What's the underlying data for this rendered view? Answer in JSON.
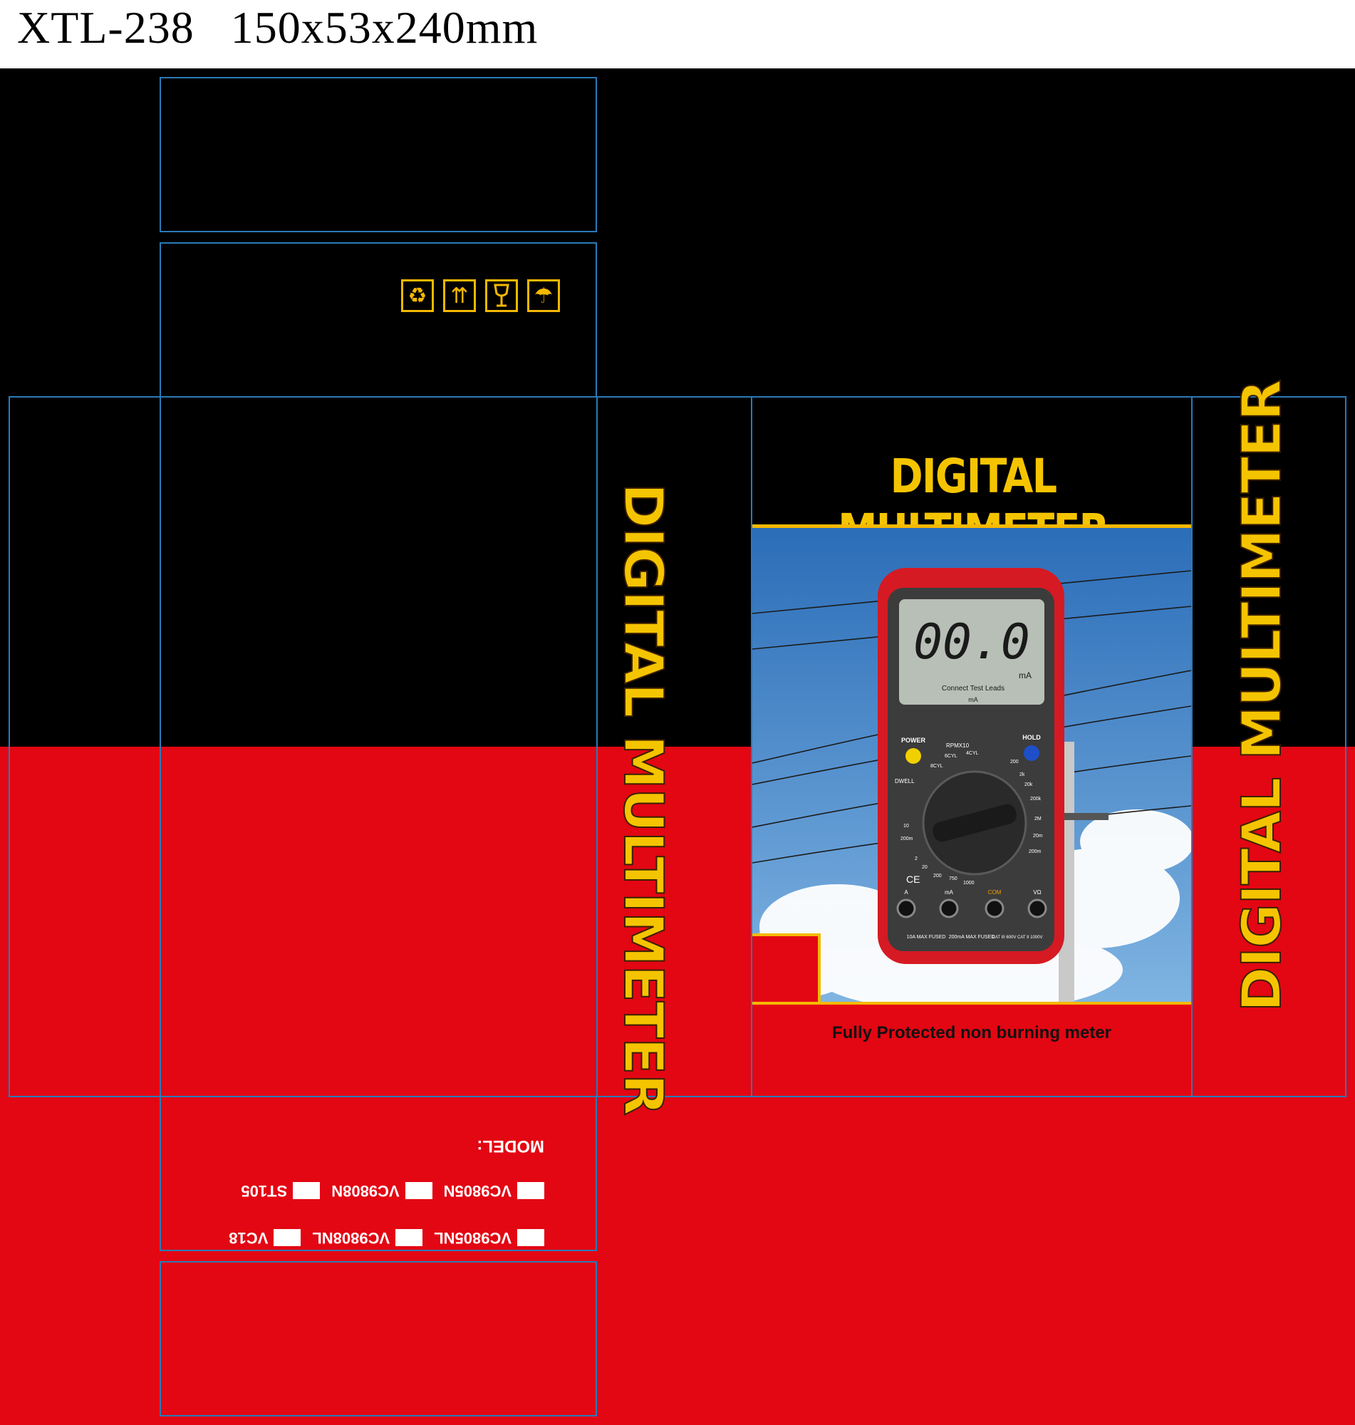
{
  "header": {
    "spec": "XTL-238   150x53x240mm"
  },
  "handling_symbols": [
    {
      "icon": "recycle-icon",
      "glyph": "♻"
    },
    {
      "icon": "this-way-up-icon",
      "glyph": "⇈"
    },
    {
      "icon": "fragile-glass-icon",
      "glyph": "🍷"
    },
    {
      "icon": "keep-dry-umbrella-icon",
      "glyph": "☂"
    }
  ],
  "side_panel_left": {
    "title": "DIGITAL MULTIMETER"
  },
  "side_panel_right": {
    "title": "DIGITAL MULTIMETER"
  },
  "front": {
    "title": "DIGITAL MULTIMETER",
    "tagline": "Fully Protected non burning meter"
  },
  "meter": {
    "display_value": "00.0",
    "display_unit": "mA",
    "warning_text": "Connect  Test  Leads",
    "probe_hint": "mA",
    "power_label": "POWER",
    "hold_label": "HOLD",
    "rpm_label": "RPMX10",
    "dwell_label": "DWELL",
    "range_labels": [
      "8CYL",
      "6CYL",
      "4CYL",
      "200",
      "2k",
      "20k",
      "200k",
      "2M",
      "20m",
      "200m",
      "2",
      "20",
      "200",
      "750",
      "1000",
      "10",
      "200m"
    ],
    "terminals": [
      "A",
      "mA",
      "COM",
      "VΩ"
    ],
    "fuse_labels": [
      "10A MAX FUSED",
      "200mA MAX FUSED",
      "CAT III 600V CAT II 1000V"
    ],
    "ce_mark": "CE"
  },
  "flap_bottom": {
    "model_label": "MODEL:",
    "models_row1": [
      "VC9805N",
      "VC9808N",
      "ST105"
    ],
    "models_row2": [
      "VC9805NL",
      "VC9808NL",
      "VC18"
    ]
  },
  "colors": {
    "black": "#000000",
    "red": "#e30613",
    "yellow": "#f5c400",
    "guide": "#2a7ab8"
  }
}
